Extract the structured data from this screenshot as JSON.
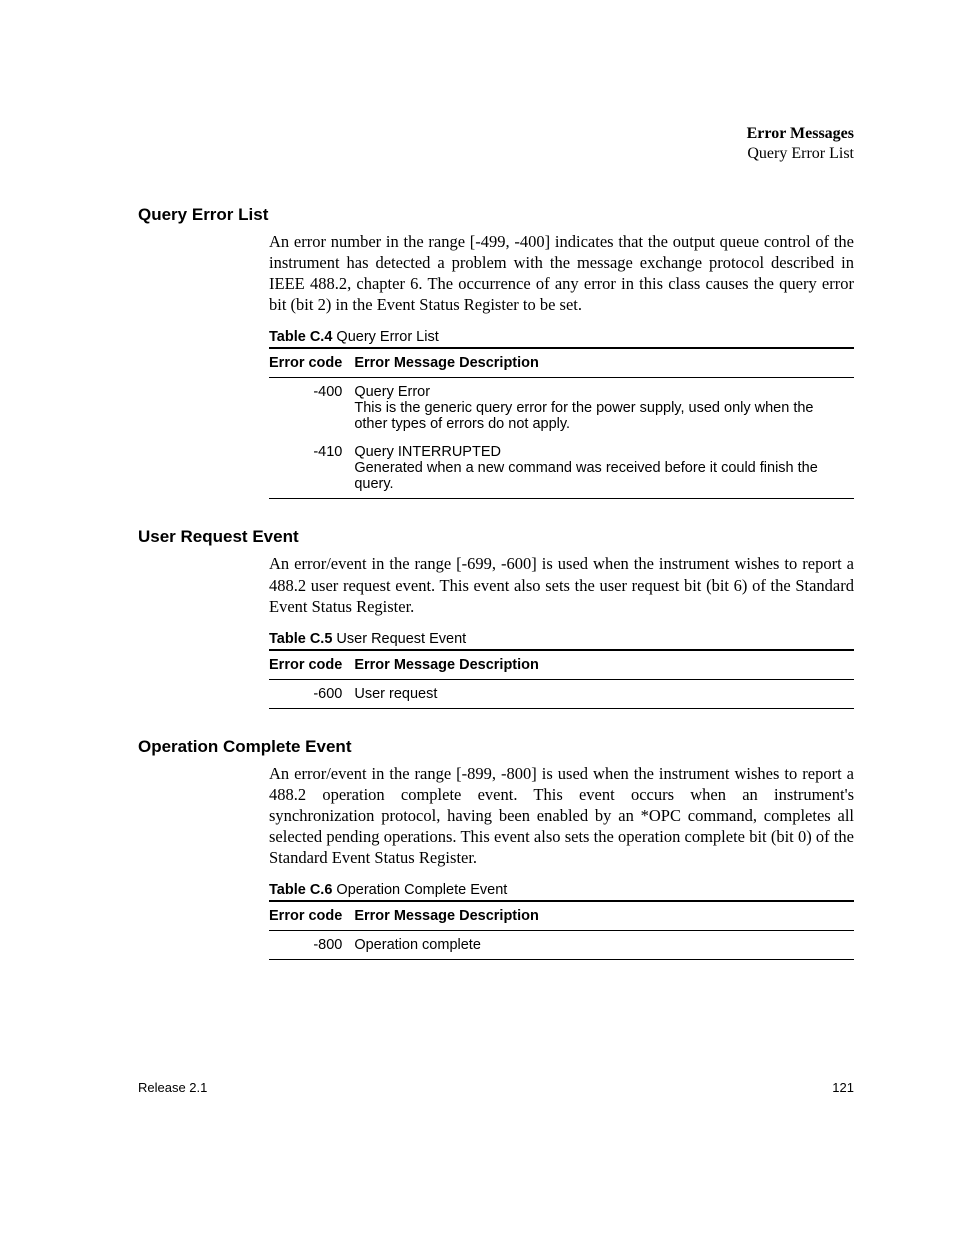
{
  "header": {
    "title": "Error Messages",
    "subtitle": "Query Error List"
  },
  "sections": {
    "query": {
      "heading": "Query Error List",
      "paragraph": "An error number in the range [-499, -400] indicates that the output queue control of the instrument has detected a problem with the message exchange protocol described in IEEE 488.2, chapter 6. The occurrence of any error in this class causes the query error bit (bit 2) in the Event Status Register to be set.",
      "table_label": "Table C.4",
      "table_caption": "Query Error List",
      "col1": "Error code",
      "col2": "Error Message Description",
      "rows": [
        {
          "code": "-400",
          "title": "Query Error",
          "body": "This is the generic query error for the power supply, used only when the other types of errors do not apply."
        },
        {
          "code": "-410",
          "title": "Query INTERRUPTED",
          "body": "Generated when a new command was received before it could finish the query."
        }
      ]
    },
    "user": {
      "heading": "User Request Event",
      "paragraph": "An error/event in the range [-699, -600] is used when the instrument wishes to report a 488.2 user request event. This event also sets the user request bit (bit 6) of the Standard Event Status Register.",
      "table_label": "Table C.5",
      "table_caption": "User Request Event",
      "col1": "Error code",
      "col2": "Error Message Description",
      "rows": [
        {
          "code": "-600",
          "title": "User request",
          "body": ""
        }
      ]
    },
    "op": {
      "heading": "Operation Complete Event",
      "paragraph": "An error/event in the range [-899, -800] is used when the instrument wishes to report a 488.2 operation complete event. This event occurs when an instrument's synchronization protocol, having been enabled by an *OPC command, completes all selected pending operations. This event also sets the operation complete bit (bit 0) of the Standard Event Status Register.",
      "table_label": "Table C.6",
      "table_caption": "Operation Complete Event",
      "col1": "Error code",
      "col2": "Error Message Description",
      "rows": [
        {
          "code": "-800",
          "title": "Operation complete",
          "body": ""
        }
      ]
    }
  },
  "footer": {
    "release": "Release 2.1",
    "page": "121"
  }
}
